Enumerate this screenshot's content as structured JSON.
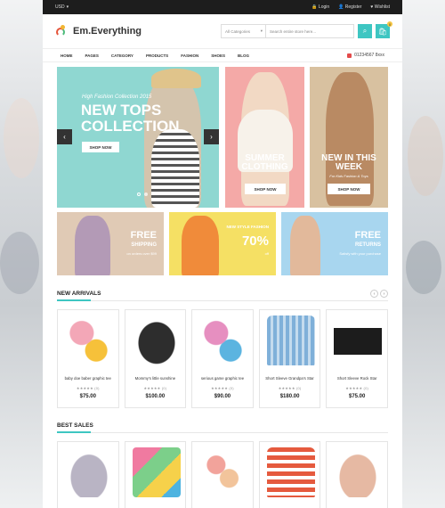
{
  "topbar": {
    "currency": "USD",
    "login": "Login",
    "register": "Register",
    "wishlist": "Wishlist"
  },
  "header": {
    "brand": "Em.Everything",
    "category_select": "All Categories",
    "search_placeholder": "Search entire store here...",
    "cart_count": "0"
  },
  "nav": {
    "items": [
      "HOME",
      "PAGES",
      "CATEGORY",
      "PRODUCTS",
      "FASHION",
      "SHOES",
      "BLOG"
    ],
    "phone": "01234567 8xxx"
  },
  "slider": {
    "subtitle": "High Fashion Collection 2015",
    "title": "NEW TOPS COLLECTION",
    "cta": "SHOP NOW"
  },
  "banner_summer": {
    "title": "SUMMER CLOTHING",
    "cta": "SHOP NOW"
  },
  "banner_new": {
    "title": "NEW IN THIS WEEK",
    "sub": "For Kids Fashion & Toys",
    "cta": "SHOP NOW"
  },
  "promos": [
    {
      "t1": "FREE",
      "t2": "SHIPPING",
      "t3": "on orders over $99"
    },
    {
      "t1": "70%",
      "t2": "NEW STYLE FASHION",
      "t3": "off"
    },
    {
      "t1": "FREE",
      "t2": "RETURNS",
      "t3": "Satisfy with your purchase"
    }
  ],
  "new_arrivals": {
    "title": "NEW ARRIVALS",
    "products": [
      {
        "name": "baby doe baber graphic tee",
        "rating": "★★★★★ (0)",
        "price": "$75.00",
        "color": "#f3a7b7"
      },
      {
        "name": "Mommy's little sunshine",
        "rating": "★★★★★ (0)",
        "price": "$100.00",
        "color": "#2d2d2d"
      },
      {
        "name": "serious game graphic tee",
        "rating": "★★★★★ (0)",
        "price": "$90.00",
        "color": "#e68fc0"
      },
      {
        "name": "Short Sleeve Grandpa's Star",
        "rating": "★★★★★ (0)",
        "price": "$180.00",
        "color": "#7fb0d9"
      },
      {
        "name": "Short Sleeve Rock Star",
        "rating": "★★★★★ (0)",
        "price": "$75.00",
        "color": "#1c1c1c"
      }
    ]
  },
  "best_sales": {
    "title": "BEST SALES",
    "products": [
      {
        "color": "#b9b4c4"
      },
      {
        "color": "#f07aa0"
      },
      {
        "color": "#f2a39b"
      },
      {
        "color": "#e55a3e"
      },
      {
        "color": "#e6b9a3"
      }
    ]
  },
  "colors": {
    "accent": "#3ec6c2",
    "topbar": "#1d1d1d"
  }
}
